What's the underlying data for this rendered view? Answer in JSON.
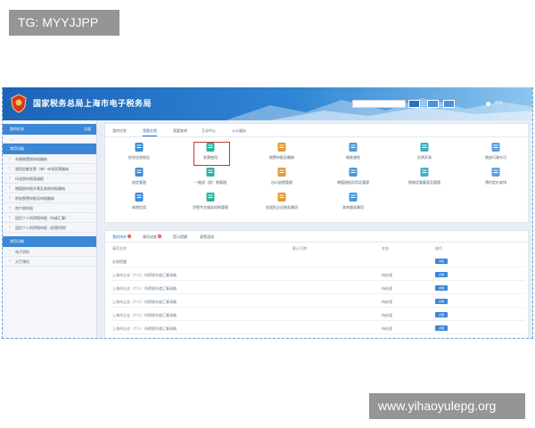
{
  "watermarks": {
    "top_left": "TG: MYYJJPP",
    "bottom_right": "www.yihaoyulepg.org"
  },
  "header": {
    "title": "国家税务总局上海市电子税务局",
    "exit_label": "退出"
  },
  "sidebar": {
    "section1": {
      "label": "我的信息",
      "right": "全部"
    },
    "section1_note": "...",
    "section2": {
      "label": "常用功能"
    },
    "items": [
      "车辆购置税申报缴纳",
      "通用定额发票（单）申领发票缴纳",
      "印花税申报表填报",
      "增值税申报开票及其他申报缴纳",
      "附加税费申报及申报缴纳",
      "房产税申报",
      "居民个人所得税申报（年度汇算）",
      "居民个人所得税申报（经营所得）"
    ],
    "section3": {
      "label": "常用功能"
    },
    "items2": [
      "电子资料",
      "大厅预约"
    ]
  },
  "main": {
    "tabs": [
      "我的信息",
      "我要办税",
      "我要查询",
      "互动中心",
      "公众服务"
    ],
    "active_tab": 1,
    "functions": [
      {
        "label": "综合信息报告",
        "icon": "report-icon"
      },
      {
        "label": "发票使用",
        "icon": "invoice-icon"
      },
      {
        "label": "税费申报及缴纳",
        "icon": "tax-declare-icon"
      },
      {
        "label": "税收减免",
        "icon": "tax-reduce-icon"
      },
      {
        "label": "证明开具",
        "icon": "certificate-icon"
      },
      {
        "label": "税务行政许可",
        "icon": "permit-icon"
      },
      {
        "label": "核定管理",
        "icon": "verify-icon"
      },
      {
        "label": "一般退（抵）税管理",
        "icon": "refund-icon"
      },
      {
        "label": "出口退税管理",
        "icon": "export-refund-icon"
      },
      {
        "label": "增值税抵扣凭证管理",
        "icon": "deduction-icon"
      },
      {
        "label": "税收优惠备案及管理",
        "icon": "preference-icon"
      },
      {
        "label": "预约定价安排",
        "icon": "pricing-icon"
      },
      {
        "label": "纳税信用",
        "icon": "credit-icon"
      },
      {
        "label": "涉税专业服务机构管理",
        "icon": "agency-icon"
      },
      {
        "label": "非居民企业税务事项",
        "icon": "nonresident-icon"
      },
      {
        "label": "其他服务事项",
        "icon": "other-service-icon"
      }
    ]
  },
  "lower": {
    "tabs": [
      {
        "label": "我的待办",
        "badge": "7"
      },
      {
        "label": "事项进度",
        "badge": "4"
      },
      {
        "label": "提示提醒",
        "badge": ""
      },
      {
        "label": "政策速递",
        "badge": ""
      }
    ],
    "headers": [
      "事项名称",
      "截止日期",
      "状态",
      "操作"
    ],
    "rows": [
      {
        "name": "办税提醒",
        "status": "",
        "action": "详情"
      },
      {
        "name": "上海市企业（个人）所得税年度汇算清缴",
        "status": "待处理",
        "action": "办理"
      },
      {
        "name": "上海市企业（个人）所得税年度汇算清缴",
        "status": "待处理",
        "action": "办理"
      },
      {
        "name": "上海市企业（个人）所得税年度汇算清缴",
        "status": "待处理",
        "action": "办理"
      },
      {
        "name": "上海市企业（个人）所得税年度汇算清缴",
        "status": "待处理",
        "action": "办理"
      },
      {
        "name": "上海市企业（个人）所得税年度汇算清缴",
        "status": "待处理",
        "action": "办理"
      }
    ]
  },
  "colors": {
    "header_blue": "#2f86d4",
    "sidebar_head": "#3b86d6",
    "highlight_red": "#c23a2e",
    "button_blue": "#3b86d6"
  }
}
